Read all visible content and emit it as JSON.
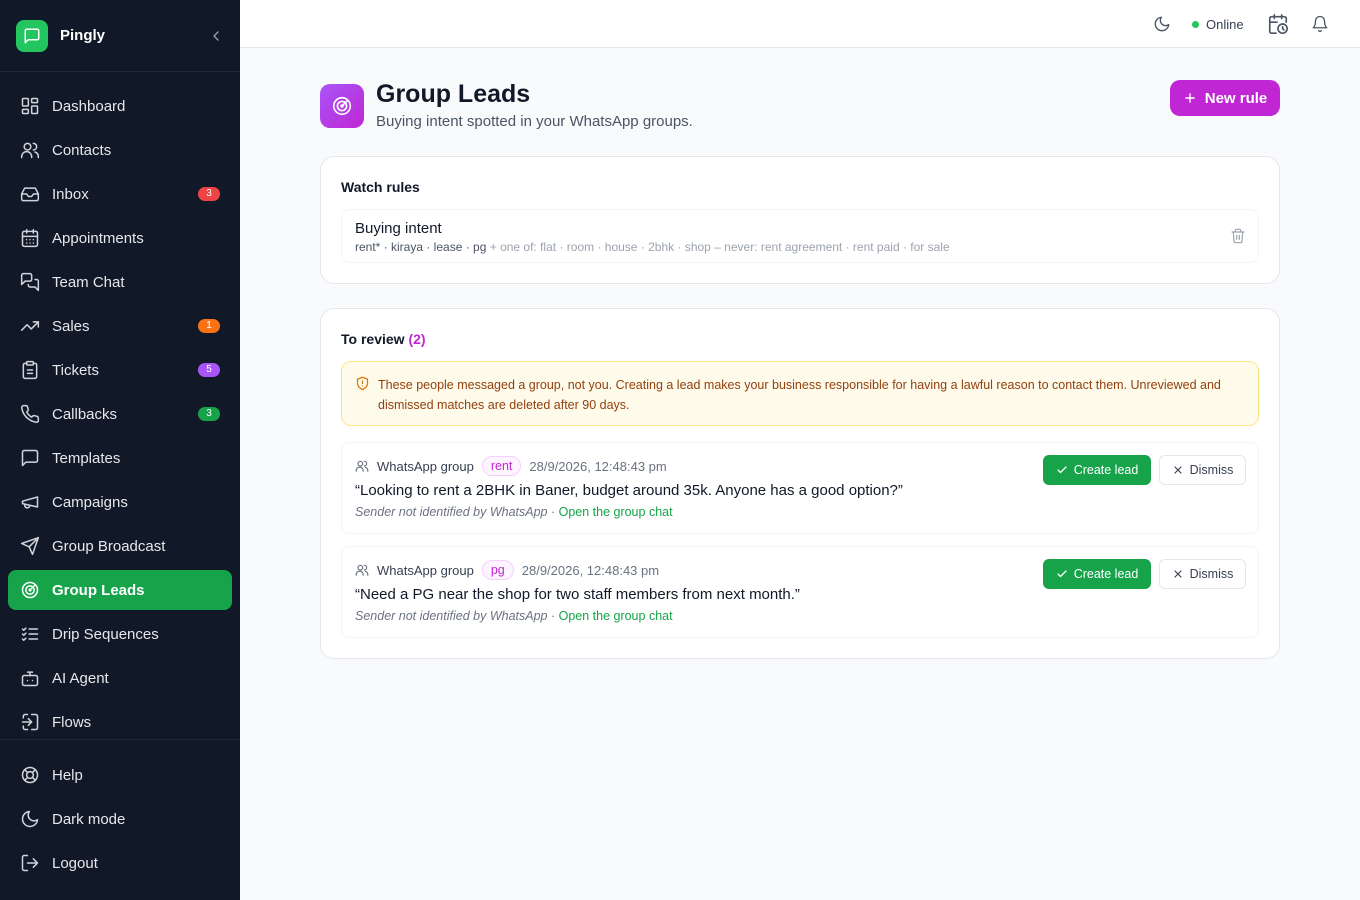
{
  "app": {
    "name": "Pingly"
  },
  "sidebar": {
    "items": [
      {
        "label": "Dashboard",
        "icon": "dashboard-icon"
      },
      {
        "label": "Contacts",
        "icon": "contacts-icon"
      },
      {
        "label": "Inbox",
        "icon": "inbox-icon",
        "badge": "3",
        "badge_color": "#ef4444"
      },
      {
        "label": "Appointments",
        "icon": "calendar-icon"
      },
      {
        "label": "Team Chat",
        "icon": "chat-icon"
      },
      {
        "label": "Sales",
        "icon": "trending-up-icon",
        "badge": "1",
        "badge_color": "#f97316"
      },
      {
        "label": "Tickets",
        "icon": "clipboard-icon",
        "badge": "5",
        "badge_color": "#a855f7"
      },
      {
        "label": "Callbacks",
        "icon": "phone-icon",
        "badge": "3",
        "badge_color": "#16a34a"
      },
      {
        "label": "Templates",
        "icon": "message-square-icon"
      },
      {
        "label": "Campaigns",
        "icon": "megaphone-icon"
      },
      {
        "label": "Group Broadcast",
        "icon": "send-icon"
      },
      {
        "label": "Group Leads",
        "icon": "radar-icon",
        "active": true
      },
      {
        "label": "Drip Sequences",
        "icon": "list-checks-icon"
      },
      {
        "label": "AI Agent",
        "icon": "bot-icon"
      },
      {
        "label": "Flows",
        "icon": "flow-icon"
      }
    ],
    "bottom": [
      {
        "label": "Help",
        "icon": "help-icon"
      },
      {
        "label": "Dark mode",
        "icon": "moon-icon"
      },
      {
        "label": "Logout",
        "icon": "logout-icon"
      }
    ]
  },
  "topbar": {
    "status": "Online",
    "status_color": "#22c55e"
  },
  "page": {
    "title": "Group Leads",
    "subtitle": "Buying intent spotted in your WhatsApp groups.",
    "new_rule_label": "New rule"
  },
  "watch_rules": {
    "title": "Watch rules",
    "rules": [
      {
        "name": "Buying intent",
        "keywords": "rent* · kiraya · lease · pg",
        "extra": " + one of: flat · room · house · 2bhk · shop – never: rent agreement · rent paid · for sale"
      }
    ]
  },
  "review": {
    "title": "To review",
    "count": "(2)",
    "warning": "These people messaged a group, not you. Creating a lead makes your business responsible for having a lawful reason to contact them. Unreviewed and dismissed matches are deleted after 90 days.",
    "matches": [
      {
        "source": "WhatsApp group",
        "tag": "rent",
        "time": "28/9/2026, 12:48:43 pm",
        "quote": "“Looking to rent a 2BHK in Baner, budget around 35k. Anyone has a good option?”",
        "sender": "Sender not identified by WhatsApp",
        "link": "Open the group chat",
        "create_label": "Create lead",
        "dismiss_label": "Dismiss"
      },
      {
        "source": "WhatsApp group",
        "tag": "pg",
        "time": "28/9/2026, 12:48:43 pm",
        "quote": "“Need a PG near the shop for two staff members from next month.”",
        "sender": "Sender not identified by WhatsApp",
        "link": "Open the group chat",
        "create_label": "Create lead",
        "dismiss_label": "Dismiss"
      }
    ]
  }
}
